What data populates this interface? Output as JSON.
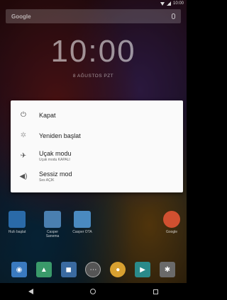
{
  "statusbar": {
    "time": "10:00"
  },
  "search": {
    "label": "Google"
  },
  "lockclock": {
    "time": "10:00",
    "date": "8 AĞUSTOS PZT"
  },
  "apps": [
    {
      "label": "Hızlı başlat",
      "color": "#2a6aa8"
    },
    {
      "label": "Casper Sanema",
      "color": "#4a7fb0"
    },
    {
      "label": "Casper OTA",
      "color": "#4a8ac0"
    },
    {
      "label": "Google",
      "color": "#d05030"
    }
  ],
  "dock": [
    {
      "icon": "camera-icon",
      "color": "#3a7abf"
    },
    {
      "icon": "gallery-icon",
      "color": "#3a9a6a"
    },
    {
      "icon": "contacts-icon",
      "color": "#3a6aa0"
    },
    {
      "icon": "apps-drawer-icon",
      "color": "#555555"
    },
    {
      "icon": "chrome-icon",
      "color": "#d8a030"
    },
    {
      "icon": "play-store-icon",
      "color": "#2a8a8a"
    },
    {
      "icon": "settings-icon",
      "color": "#6a6a6a"
    }
  ],
  "dialog": {
    "items": [
      {
        "title": "Kapat",
        "sub": ""
      },
      {
        "title": "Yeniden başlat",
        "sub": ""
      },
      {
        "title": "Uçak modu",
        "sub": "Uçak modu KAPALI"
      },
      {
        "title": "Sessiz mod",
        "sub": "Ses AÇIK"
      }
    ]
  }
}
